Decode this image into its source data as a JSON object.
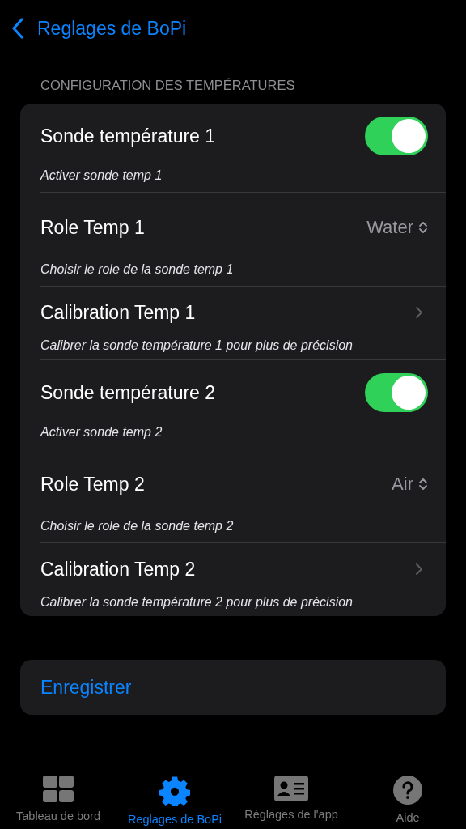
{
  "nav": {
    "back_label": "Reglages de BoPi"
  },
  "section": {
    "header": "CONFIGURATION DES TEMPÉRATURES",
    "rows": [
      {
        "kind": "toggle",
        "title": "Sonde température 1",
        "subtitle": "Activer sonde temp 1",
        "on": true
      },
      {
        "kind": "picker",
        "title": "Role Temp 1",
        "subtitle": "Choisir le role de la sonde temp 1",
        "value": "Water"
      },
      {
        "kind": "link",
        "title": "Calibration Temp 1",
        "subtitle": "Calibrer la sonde température 1 pour plus de précision"
      },
      {
        "kind": "toggle",
        "title": "Sonde température 2",
        "subtitle": "Activer sonde temp 2",
        "on": true
      },
      {
        "kind": "picker",
        "title": "Role Temp 2",
        "subtitle": "Choisir le role de la sonde temp 2",
        "value": "Air"
      },
      {
        "kind": "link",
        "title": "Calibration Temp 2",
        "subtitle": "Calibrer la sonde température 2 pour plus de précision"
      }
    ]
  },
  "save_button": "Enregistrer",
  "tabs": [
    {
      "label": "Tableau de bord",
      "selected": false
    },
    {
      "label": "Reglages de BoPi",
      "selected": true
    },
    {
      "label": "Réglages de l'app",
      "selected": false
    },
    {
      "label": "Aide",
      "selected": false
    }
  ]
}
